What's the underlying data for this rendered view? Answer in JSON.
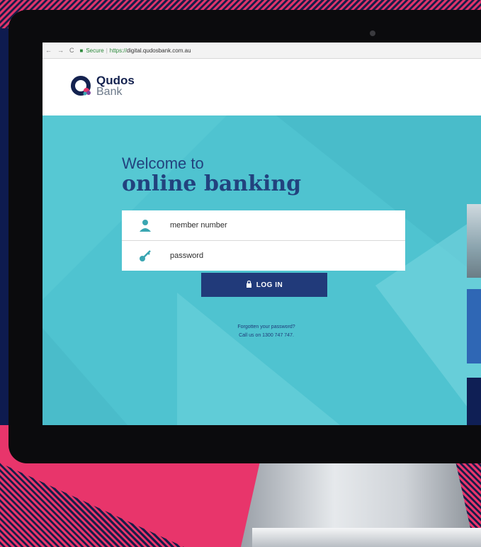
{
  "browser": {
    "back": "←",
    "forward": "→",
    "reload": "C",
    "secure_label": "Secure",
    "url_proto": "https://",
    "url_rest": "digital.qudosbank.com.au"
  },
  "logo": {
    "name": "Qudos",
    "sub": "Bank"
  },
  "hero": {
    "welcome_line1": "Welcome to",
    "welcome_line2": "online banking"
  },
  "login": {
    "member_placeholder": "member number",
    "password_placeholder": "password",
    "button_label": "LOG IN"
  },
  "help": {
    "forgot": "Forgotten your password?",
    "call": "Call us on 1300 747 747."
  },
  "colors": {
    "teal": "#4fc3d0",
    "navy": "#213a7a",
    "pink": "#e8356b"
  }
}
